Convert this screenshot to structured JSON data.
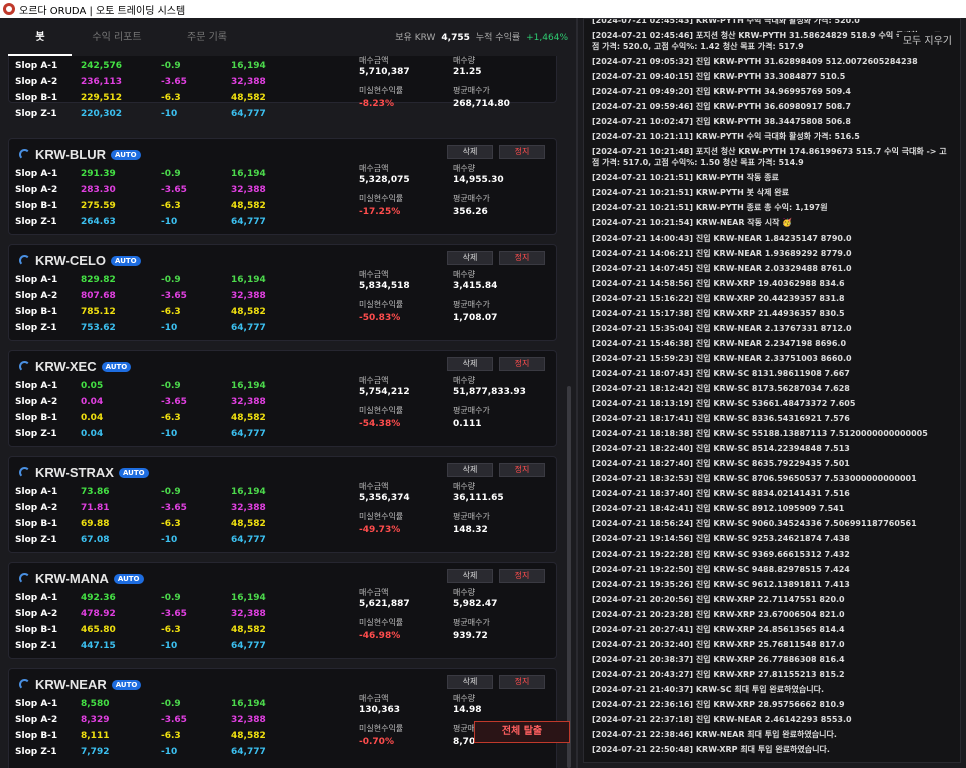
{
  "window": {
    "title": "오르다 ORUDA | 오토 트레이딩 시스템"
  },
  "tabs": [
    "봇",
    "수익 리포트",
    "주문 기록"
  ],
  "summary": {
    "label1": "보유 KRW",
    "krw": "4,755",
    "label2": "누적 수익률",
    "rate": "+1,464%"
  },
  "labels": {
    "buy_amount": "매수금액",
    "qty": "매수량",
    "unrealized": "미실현수익률",
    "avg_price": "평균매수가",
    "delete": "삭제",
    "stop": "정지",
    "auto": "AUTO",
    "exit_all": "전체 탈출",
    "clear_all": "모두 지우기"
  },
  "slop_labels": [
    "Slop A-1",
    "Slop A-2",
    "Slop B-1",
    "Slop Z-1"
  ],
  "slop_pcts": [
    "-0.9",
    "-3.65",
    "-6.3",
    "-10"
  ],
  "slop_amts": [
    "16,194",
    "32,388",
    "48,582",
    "64,777"
  ],
  "bots": [
    {
      "name": "",
      "prices": [
        "242,576",
        "236,113",
        "229,512",
        "220,302"
      ],
      "buy_amount": "5,710,387",
      "qty": "21.25",
      "unrealized": "-8.23%",
      "avg_price": "268,714.80"
    },
    {
      "name": "KRW-BLUR",
      "prices": [
        "291.39",
        "283.30",
        "275.59",
        "264.63"
      ],
      "buy_amount": "5,328,075",
      "qty": "14,955.30",
      "unrealized": "-17.25%",
      "avg_price": "356.26"
    },
    {
      "name": "KRW-CELO",
      "prices": [
        "829.82",
        "807.68",
        "785.12",
        "753.62"
      ],
      "buy_amount": "5,834,518",
      "qty": "3,415.84",
      "unrealized": "-50.83%",
      "avg_price": "1,708.07"
    },
    {
      "name": "KRW-XEC",
      "prices": [
        "0.05",
        "0.04",
        "0.04",
        "0.04"
      ],
      "buy_amount": "5,754,212",
      "qty": "51,877,833.93",
      "unrealized": "-54.38%",
      "avg_price": "0.111"
    },
    {
      "name": "KRW-STRAX",
      "prices": [
        "73.86",
        "71.81",
        "69.88",
        "67.08"
      ],
      "buy_amount": "5,356,374",
      "qty": "36,111.65",
      "unrealized": "-49.73%",
      "avg_price": "148.32"
    },
    {
      "name": "KRW-MANA",
      "prices": [
        "492.36",
        "478.92",
        "465.80",
        "447.15"
      ],
      "buy_amount": "5,621,887",
      "qty": "5,982.47",
      "unrealized": "-46.98%",
      "avg_price": "939.72"
    },
    {
      "name": "KRW-NEAR",
      "prices": [
        "8,580",
        "8,329",
        "8,111",
        "7,792"
      ],
      "buy_amount": "130,363",
      "qty": "14.98",
      "unrealized": "-0.70%",
      "avg_price": "8,70"
    }
  ],
  "log": [
    "[2024-07-21 02:45:43] KRW-PYTH 수익 극대화 활성화 가격: 520.0",
    "[2024-07-21 02:45:46] 포지션 청산 KRW-PYTH 31.58624829 518.9 수익 극대화 -> 고점 가격: 520.0, 고점 수익%: 1.42 청산 목표 가격: 517.9",
    "[2024-07-21 09:05:32] 진입 KRW-PYTH 31.62898409 512.0072605284238",
    "[2024-07-21 09:40:15] 진입 KRW-PYTH 33.3084877 510.5",
    "[2024-07-21 09:49:20] 진입 KRW-PYTH 34.96995769 509.4",
    "[2024-07-21 09:59:46] 진입 KRW-PYTH 36.60980917 508.7",
    "[2024-07-21 10:02:47] 진입 KRW-PYTH 38.34475808 506.8",
    "[2024-07-21 10:21:11] KRW-PYTH 수익 극대화 활성화 가격: 516.5",
    "[2024-07-21 10:21:48] 포지션 청산 KRW-PYTH 174.86199673 515.7 수익 극대화 -> 고점 가격: 517.0, 고점 수익%: 1.50 청산 목표 가격: 514.9",
    "[2024-07-21 10:21:51] KRW-PYTH 작동 종료",
    "[2024-07-21 10:21:51] KRW-PYTH 봇 삭제 완료",
    "[2024-07-21 10:21:51] KRW-PYTH 종료 총 수익: 1,197원",
    "[2024-07-21 10:21:54] KRW-NEAR 작동 시작 🥳",
    "[2024-07-21 14:00:43] 진입 KRW-NEAR 1.84235147 8790.0",
    "[2024-07-21 14:06:21] 진입 KRW-NEAR 1.93689292 8779.0",
    "[2024-07-21 14:07:45] 진입 KRW-NEAR 2.03329488 8761.0",
    "[2024-07-21 14:58:56] 진입 KRW-XRP 19.40362988 834.6",
    "[2024-07-21 15:16:22] 진입 KRW-XRP 20.44239357 831.8",
    "[2024-07-21 15:17:38] 진입 KRW-XRP 21.44936357 830.5",
    "[2024-07-21 15:35:04] 진입 KRW-NEAR 2.13767331 8712.0",
    "[2024-07-21 15:46:38] 진입 KRW-NEAR 2.2347198 8696.0",
    "[2024-07-21 15:59:23] 진입 KRW-NEAR 2.33751003 8660.0",
    "[2024-07-21 18:07:43] 진입 KRW-SC 8131.98611908 7.667",
    "[2024-07-21 18:12:42] 진입 KRW-SC 8173.56287034 7.628",
    "[2024-07-21 18:13:19] 진입 KRW-SC 53661.48473372 7.605",
    "[2024-07-21 18:17:41] 진입 KRW-SC 8336.54316921 7.576",
    "[2024-07-21 18:18:38] 진입 KRW-SC 55188.13887113 7.5120000000000005",
    "[2024-07-21 18:22:40] 진입 KRW-SC 8514.22394848 7.513",
    "[2024-07-21 18:27:40] 진입 KRW-SC 8635.79229435 7.501",
    "[2024-07-21 18:32:53] 진입 KRW-SC 8706.59650537 7.533000000000001",
    "[2024-07-21 18:37:40] 진입 KRW-SC 8834.02141431 7.516",
    "[2024-07-21 18:42:41] 진입 KRW-SC 8912.1095909 7.541",
    "[2024-07-21 18:56:24] 진입 KRW-SC 9060.34524336 7.506991187760561",
    "[2024-07-21 19:14:56] 진입 KRW-SC 9253.24621874 7.438",
    "[2024-07-21 19:22:28] 진입 KRW-SC 9369.66615312 7.432",
    "[2024-07-21 19:22:50] 진입 KRW-SC 9488.82978515 7.424",
    "[2024-07-21 19:35:26] 진입 KRW-SC 9612.13891811 7.413",
    "[2024-07-21 20:20:56] 진입 KRW-XRP 22.71147551 820.0",
    "[2024-07-21 20:23:28] 진입 KRW-XRP 23.67006504 821.0",
    "[2024-07-21 20:27:41] 진입 KRW-XRP 24.85613565 814.4",
    "[2024-07-21 20:32:40] 진입 KRW-XRP 25.76811548 817.0",
    "[2024-07-21 20:38:37] 진입 KRW-XRP 26.77886308 816.4",
    "[2024-07-21 20:43:27] 진입 KRW-XRP 27.81155213 815.2",
    "[2024-07-21 21:40:37] KRW-SC 최대 투입 완료하였습니다.",
    "[2024-07-21 22:36:16] 진입 KRW-XRP 28.95756662 810.9",
    "[2024-07-21 22:37:18] 진입 KRW-NEAR 2.46142293 8553.0",
    "[2024-07-21 22:38:46] KRW-NEAR 최대 투입 완료하였습니다.",
    "[2024-07-21 22:50:48] KRW-XRP 최대 투입 완료하였습니다."
  ]
}
